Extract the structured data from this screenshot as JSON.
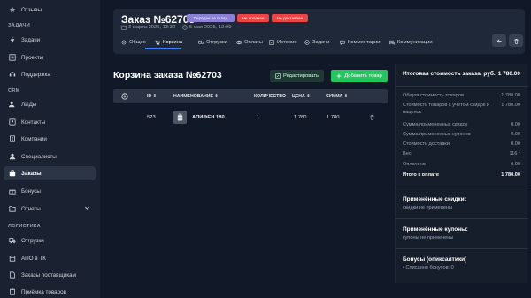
{
  "sidebar": {
    "top_item": "Отзывы",
    "sections": [
      {
        "title": "ЗАДАЧИ"
      },
      {
        "title": "CRM"
      },
      {
        "title": "ЛОГИСТИКА"
      }
    ],
    "items": {
      "tasks": "Задачи",
      "projects": "Проекты",
      "support": "Поддержка",
      "leads": "ЛИДы",
      "contacts": "Контакты",
      "companies": "Компании",
      "specialists": "Специалисты",
      "orders": "Заказы",
      "bonuses": "Бонусы",
      "reports": "Отчеты",
      "shipments": "Отгрузки",
      "apo": "АПО в ТК",
      "supplier_orders": "Заказы поставщикам",
      "goods_receipt": "Приёмка товаров"
    }
  },
  "header": {
    "title": "Заказ №62703",
    "badges": [
      "Передан на склад",
      "Не оплачен",
      "Не доставлен"
    ],
    "badge_colors": [
      "#8b7fd6",
      "#ef4444",
      "#ef4444"
    ],
    "created": "3 марта 2025, 13:32",
    "updated": "5 мая 2025, 12:09",
    "tabs": [
      "Общее",
      "Корзина",
      "Отгрузки",
      "Оплаты",
      "История",
      "Задачи",
      "Комментарии",
      "Коммуникации"
    ]
  },
  "cart": {
    "title": "Корзина заказа №62703",
    "edit_label": "Редактировать",
    "add_label": "Добавить товар",
    "columns": {
      "id": "ID",
      "name": "НАИМЕНОВАНИЕ",
      "qty": "КОЛИЧЕСТВО",
      "price": "ЦЕНА",
      "sum": "СУММА"
    },
    "rows": [
      {
        "id": "523",
        "name": "АПИФЕН 180",
        "qty": "1",
        "price": "1 780",
        "sum": "1 780"
      }
    ]
  },
  "summary": {
    "title": "Итоговая стоимость заказа, руб.",
    "total": "1 780.00",
    "rows": [
      {
        "label": "Общая стоимость товаров",
        "value": "1 780.00"
      },
      {
        "label": "Стоимость товаров с учётом скидок и наценок",
        "value": "1 780.00"
      },
      {
        "label": "Сумма примененных скидок",
        "value": "0.00"
      },
      {
        "label": "Сумма примененных купонов",
        "value": "0.00"
      },
      {
        "label": "Стоимость доставки:",
        "value": "0.00"
      },
      {
        "label": "Вес",
        "value": "116 г"
      },
      {
        "label": "Оплачено",
        "value": "0.00"
      },
      {
        "label": "Итого к оплате",
        "value": "1 780.00"
      }
    ],
    "discounts_title": "Применённые скидки:",
    "discounts_text": "скидки не применены",
    "coupons_title": "Применённые купоны:",
    "coupons_text": "купоны не применены",
    "bonus_title": "Бонусы (опиксалтики)",
    "bonus_text": "Списанно бонусов: 0"
  },
  "colors": {
    "accent": "#22c55e",
    "active_tab": "#3b82f6",
    "danger": "#ef4444"
  }
}
